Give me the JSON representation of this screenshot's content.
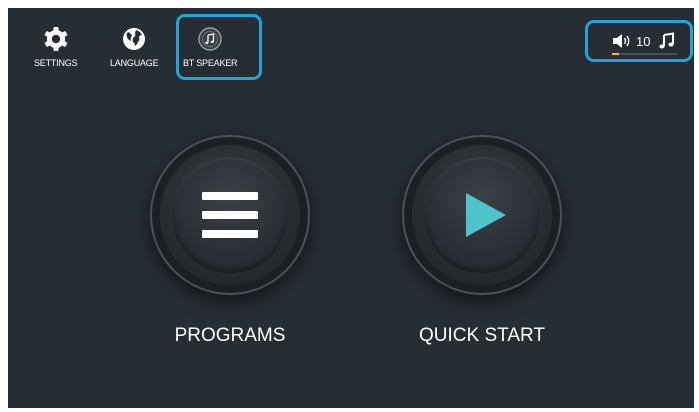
{
  "top_bar": {
    "settings": {
      "label": "SETTINGS",
      "icon": "gear-icon"
    },
    "language": {
      "label": "LANGUAGE",
      "icon": "globe-icon"
    },
    "bt_speaker": {
      "label": "BT SPEAKER",
      "icon": "music-note-circle-icon"
    }
  },
  "volume": {
    "icon": "speaker-icon",
    "value": "10",
    "music_icon": "music-notes-icon",
    "level_fraction": 0.1
  },
  "main": {
    "programs": {
      "label": "PROGRAMS",
      "icon": "menu-lines-icon"
    },
    "quick_start": {
      "label": "QUICK START",
      "icon": "play-icon"
    }
  },
  "colors": {
    "background": "#272d34",
    "highlight": "#1fa4dc",
    "accent": "#4ec3c9",
    "volume_fill": "#f0b81c"
  }
}
